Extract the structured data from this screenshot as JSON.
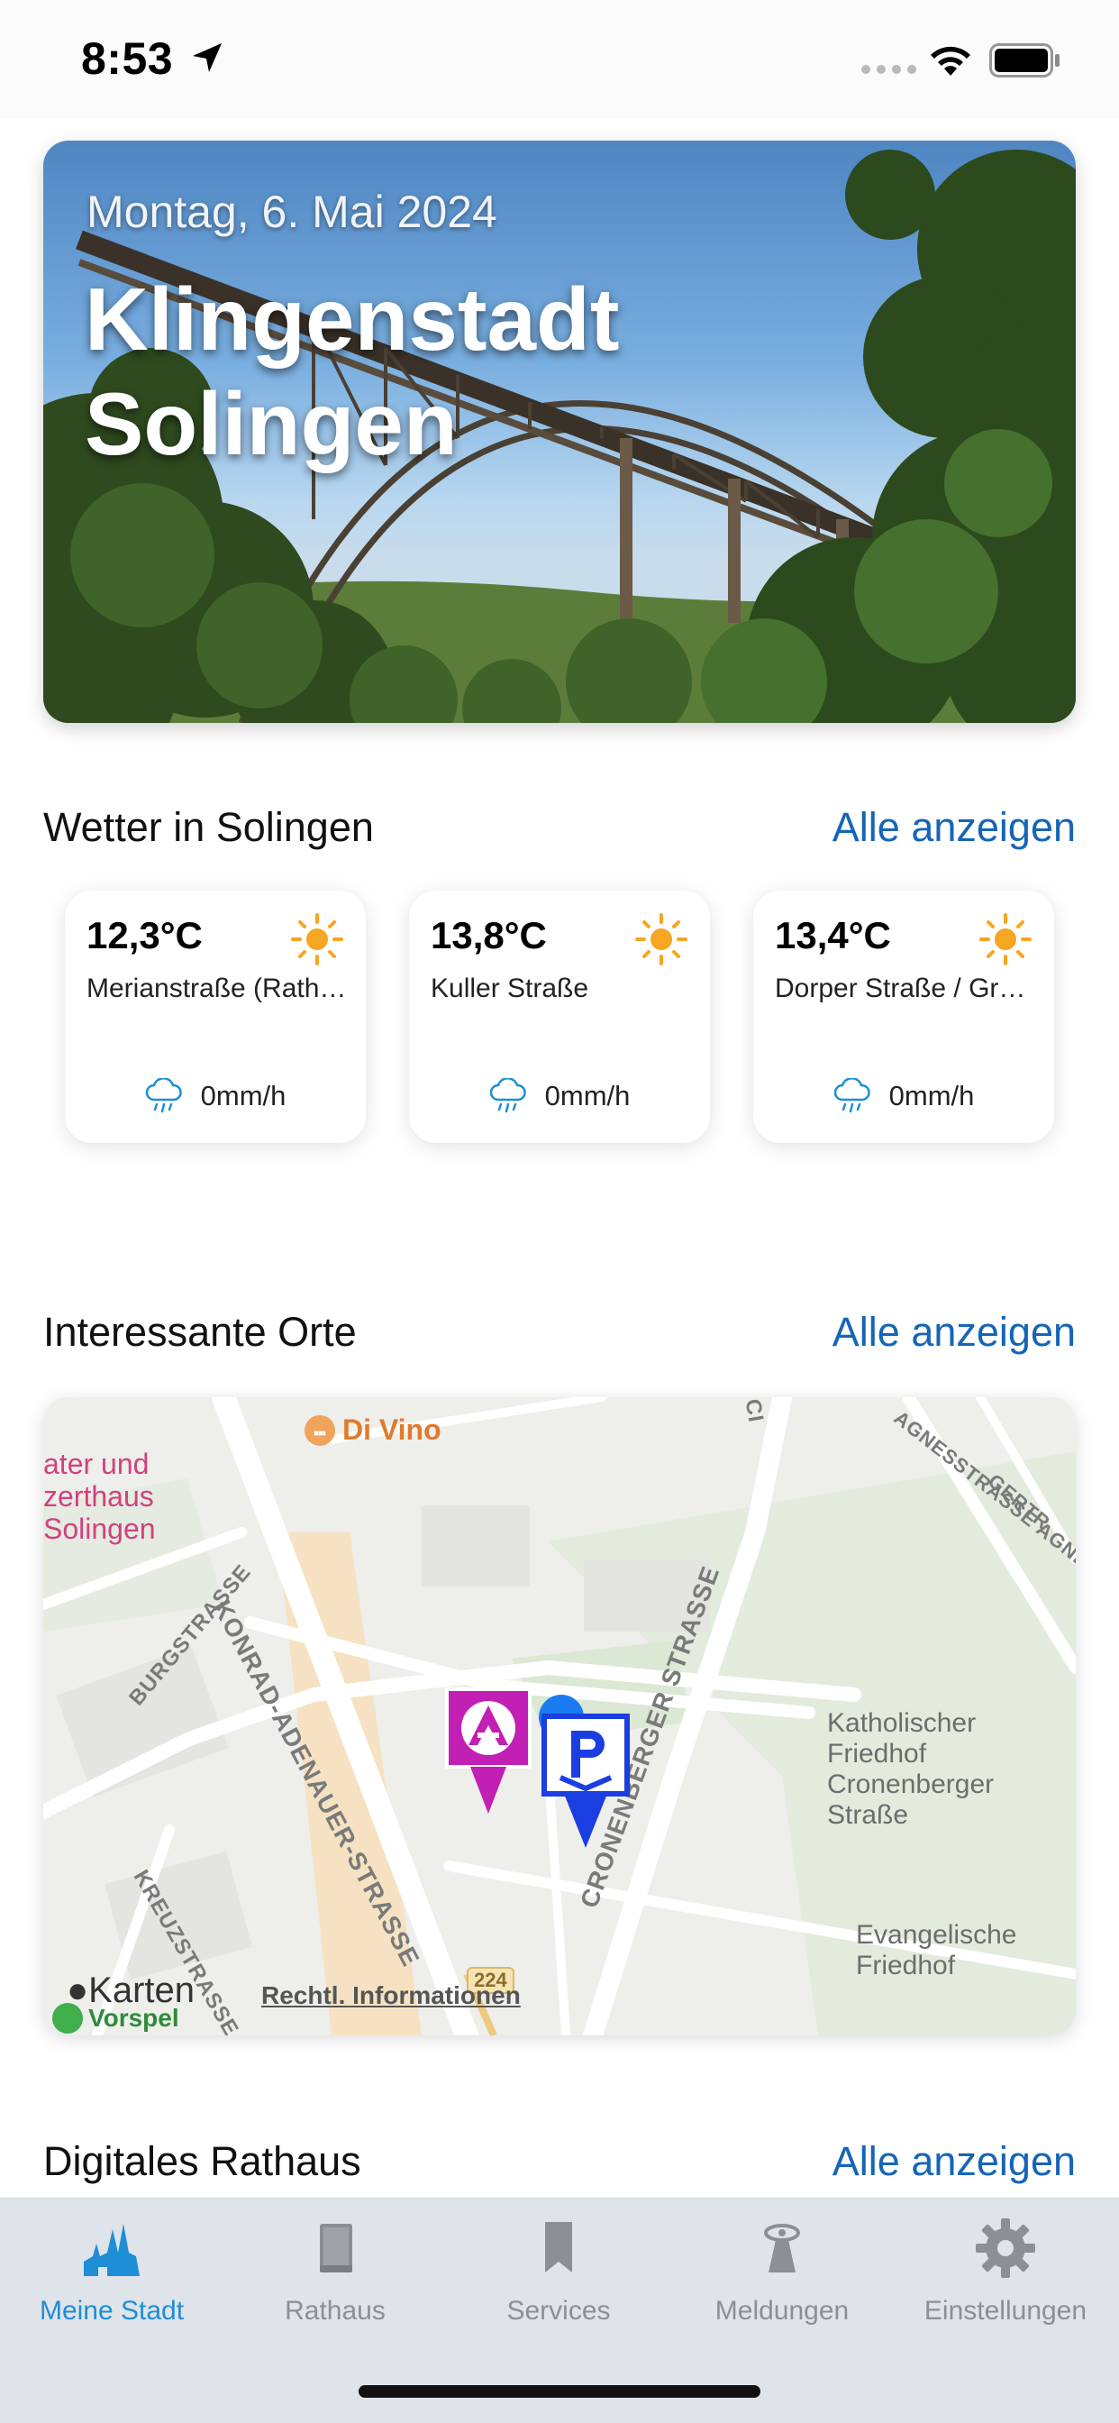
{
  "status_bar": {
    "time": "8:53"
  },
  "hero": {
    "date": "Montag, 6. Mai 2024",
    "title_line1": "Klingenstadt",
    "title_line2": "Solingen"
  },
  "weather": {
    "title": "Wetter in Solingen",
    "link": "Alle anzeigen",
    "cards": [
      {
        "temp": "12,3°C",
        "name": "Merianstraße (Rathaus)",
        "rain": "0mm/h"
      },
      {
        "temp": "13,8°C",
        "name": "Kuller Straße",
        "rain": "0mm/h"
      },
      {
        "temp": "13,4°C",
        "name": "Dorper Straße / Grünewald",
        "rain": "0mm/h"
      }
    ],
    "sun_color": "#f5a623",
    "rain_icon_color": "#1e8ed6"
  },
  "places": {
    "title": "Interessante Orte",
    "link": "Alle anzeigen",
    "map": {
      "poi_divino": "Di Vino",
      "poi_theater": [
        "ater und",
        "zerthaus",
        "Solingen"
      ],
      "poi_katholisch": [
        "Katholischer",
        "Friedhof",
        "Cronenberger",
        "Straße"
      ],
      "poi_evangelisch": [
        "Evangelische",
        "Friedhof"
      ],
      "street_konrad": "KONRAD-ADENAUER-STRASSE",
      "street_cronenberger": "CRONENBERGER STRASSE",
      "street_burg": "BURGSTRASSE",
      "street_kreuz": "KREUZSTRASSE",
      "street_agness": "AGNESSTRASSE AGNESS",
      "street_gert": "GERTR",
      "street_c": "CI",
      "road_number": "224",
      "attribution": "Karten",
      "legal": "Rechtl. Informationen",
      "vorspel": "Vorspel",
      "marker_a_color": "#c21fb4",
      "marker_p_color": "#1a3ee0"
    }
  },
  "digital": {
    "title": "Digitales Rathaus",
    "link": "Alle anzeigen"
  },
  "tabs": [
    {
      "label": "Meine Stadt",
      "icon": "city-icon",
      "active": true
    },
    {
      "label": "Rathaus",
      "icon": "book-icon",
      "active": false
    },
    {
      "label": "Services",
      "icon": "bookmark-icon",
      "active": false
    },
    {
      "label": "Meldungen",
      "icon": "megaphone-icon",
      "active": false
    },
    {
      "label": "Einstellungen",
      "icon": "gear-icon",
      "active": false
    }
  ],
  "colors": {
    "accent": "#1565b8",
    "tab_active": "#1e8ed6",
    "tab_inactive": "#8c8f94"
  }
}
